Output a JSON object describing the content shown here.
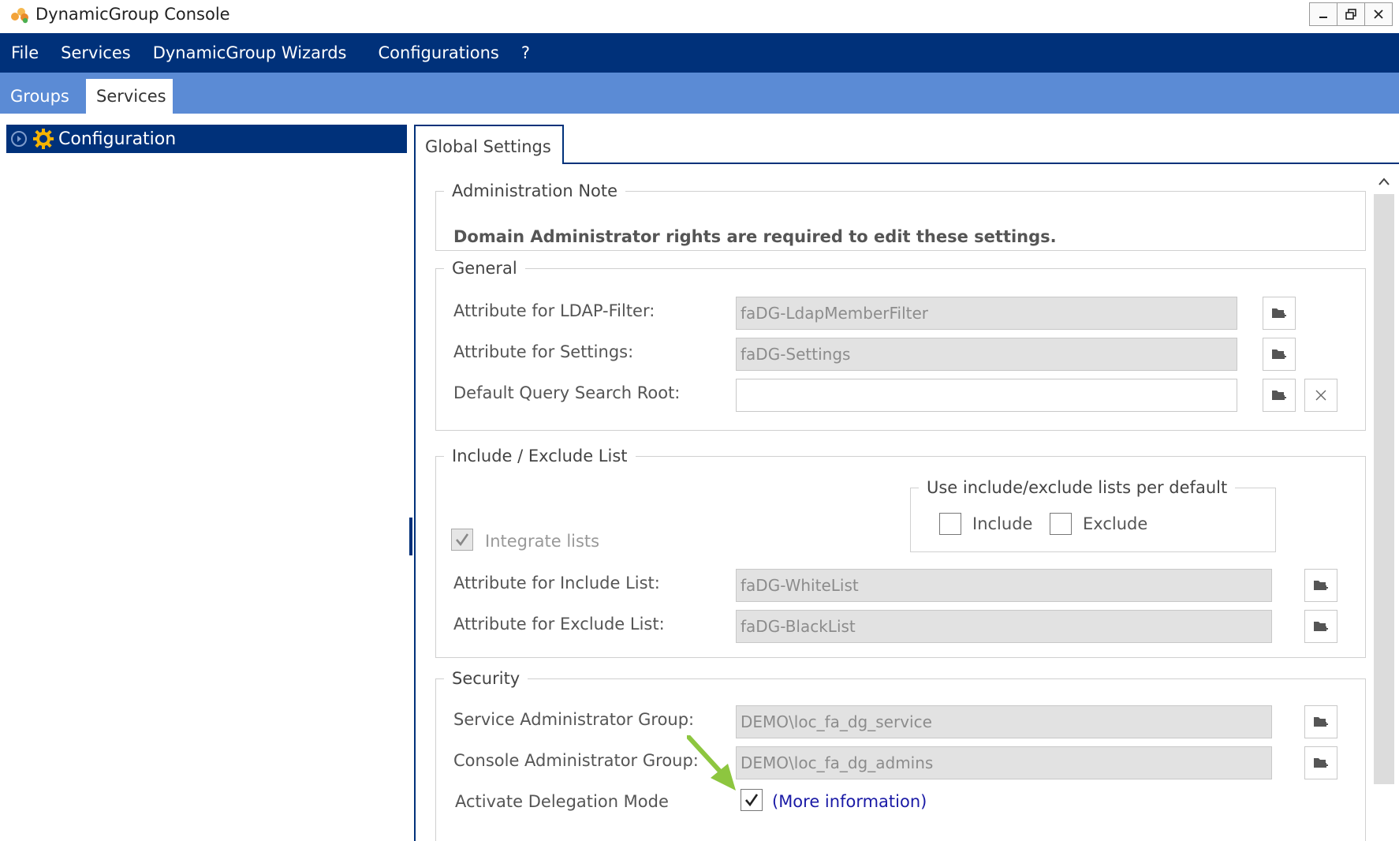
{
  "window": {
    "title": "DynamicGroup Console",
    "controls": [
      "minimize",
      "restore",
      "close"
    ]
  },
  "menu": {
    "items": [
      "File",
      "Services",
      "DynamicGroup Wizards",
      "Configurations",
      "?"
    ]
  },
  "top_tabs": [
    {
      "label": "Groups",
      "active": false
    },
    {
      "label": "Services",
      "active": true
    }
  ],
  "tree": {
    "selected_label": "Configuration",
    "icon": "gear-icon"
  },
  "settings": {
    "tab_label": "Global Settings",
    "admin_note": {
      "title": "Administration Note",
      "text": "Domain Administrator rights are required to edit these settings."
    },
    "general": {
      "title": "General",
      "rows": [
        {
          "label": "Attribute for LDAP-Filter:",
          "value": "faDG-LdapMemberFilter"
        },
        {
          "label": "Attribute for Settings:",
          "value": "faDG-Settings"
        },
        {
          "label": "Default Query Search Root:",
          "value": ""
        }
      ]
    },
    "include_exclude": {
      "title": "Include / Exclude List",
      "default_group_title": "Use include/exclude lists per default",
      "include_label": "Include",
      "include_checked": false,
      "exclude_label": "Exclude",
      "exclude_checked": false,
      "integrate_label": "Integrate lists",
      "integrate_checked": true,
      "rows": [
        {
          "label": "Attribute for Include List:",
          "value": "faDG-WhiteList"
        },
        {
          "label": "Attribute for Exclude List:",
          "value": "faDG-BlackList"
        }
      ]
    },
    "security": {
      "title": "Security",
      "rows": [
        {
          "label": "Service Administrator Group:",
          "value": "DEMO\\loc_fa_dg_service"
        },
        {
          "label": "Console Administrator Group:",
          "value": "DEMO\\loc_fa_dg_admins"
        }
      ],
      "delegation_label": "Activate Delegation Mode",
      "delegation_checked": true,
      "more_info_label": "(More information)"
    }
  },
  "colors": {
    "menu_bg": "#00317a",
    "tab_strip_bg": "#5b8bd5",
    "annotation_arrow": "#8dc63f"
  }
}
